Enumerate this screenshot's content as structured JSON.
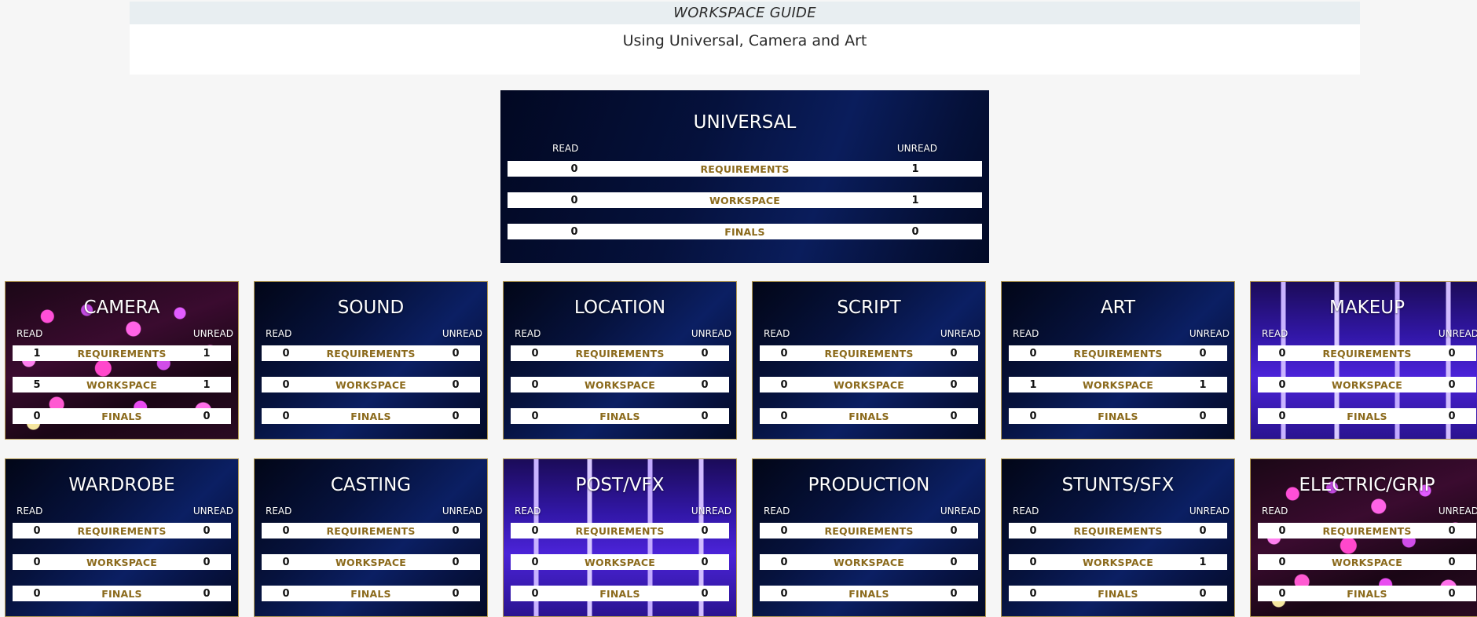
{
  "guide": {
    "title": "WORKSPACE GUIDE",
    "subtitle": "Using Universal, Camera and Art"
  },
  "columns": {
    "read": "READ",
    "unread": "UNREAD"
  },
  "row_labels": [
    "REQUIREMENTS",
    "WORKSPACE",
    "FINALS"
  ],
  "universal": {
    "title": "UNIVERSAL",
    "rows": [
      {
        "label": "REQUIREMENTS",
        "read": "0",
        "unread": "1"
      },
      {
        "label": "WORKSPACE",
        "read": "0",
        "unread": "1"
      },
      {
        "label": "FINALS",
        "read": "0",
        "unread": "0"
      }
    ]
  },
  "cards": [
    {
      "title": "CAMERA",
      "background": "lights",
      "rows": [
        {
          "label": "REQUIREMENTS",
          "read": "1",
          "unread": "1"
        },
        {
          "label": "WORKSPACE",
          "read": "5",
          "unread": "1"
        },
        {
          "label": "FINALS",
          "read": "0",
          "unread": "0"
        }
      ]
    },
    {
      "title": "SOUND",
      "background": "navy",
      "rows": [
        {
          "label": "REQUIREMENTS",
          "read": "0",
          "unread": "0"
        },
        {
          "label": "WORKSPACE",
          "read": "0",
          "unread": "0"
        },
        {
          "label": "FINALS",
          "read": "0",
          "unread": "0"
        }
      ]
    },
    {
      "title": "LOCATION",
      "background": "navy",
      "rows": [
        {
          "label": "REQUIREMENTS",
          "read": "0",
          "unread": "0"
        },
        {
          "label": "WORKSPACE",
          "read": "0",
          "unread": "0"
        },
        {
          "label": "FINALS",
          "read": "0",
          "unread": "0"
        }
      ]
    },
    {
      "title": "SCRIPT",
      "background": "navy",
      "rows": [
        {
          "label": "REQUIREMENTS",
          "read": "0",
          "unread": "0"
        },
        {
          "label": "WORKSPACE",
          "read": "0",
          "unread": "0"
        },
        {
          "label": "FINALS",
          "read": "0",
          "unread": "0"
        }
      ]
    },
    {
      "title": "ART",
      "background": "navy",
      "rows": [
        {
          "label": "REQUIREMENTS",
          "read": "0",
          "unread": "0"
        },
        {
          "label": "WORKSPACE",
          "read": "1",
          "unread": "1"
        },
        {
          "label": "FINALS",
          "read": "0",
          "unread": "0"
        }
      ]
    },
    {
      "title": "MAKEUP",
      "background": "stage",
      "rows": [
        {
          "label": "REQUIREMENTS",
          "read": "0",
          "unread": "0"
        },
        {
          "label": "WORKSPACE",
          "read": "0",
          "unread": "0"
        },
        {
          "label": "FINALS",
          "read": "0",
          "unread": "0"
        }
      ]
    },
    {
      "title": "WARDROBE",
      "background": "navy",
      "rows": [
        {
          "label": "REQUIREMENTS",
          "read": "0",
          "unread": "0"
        },
        {
          "label": "WORKSPACE",
          "read": "0",
          "unread": "0"
        },
        {
          "label": "FINALS",
          "read": "0",
          "unread": "0"
        }
      ]
    },
    {
      "title": "CASTING",
      "background": "navy",
      "rows": [
        {
          "label": "REQUIREMENTS",
          "read": "0",
          "unread": "0"
        },
        {
          "label": "WORKSPACE",
          "read": "0",
          "unread": "0"
        },
        {
          "label": "FINALS",
          "read": "0",
          "unread": "0"
        }
      ]
    },
    {
      "title": "POST/VFX",
      "background": "stage",
      "rows": [
        {
          "label": "REQUIREMENTS",
          "read": "0",
          "unread": "0"
        },
        {
          "label": "WORKSPACE",
          "read": "0",
          "unread": "0"
        },
        {
          "label": "FINALS",
          "read": "0",
          "unread": "0"
        }
      ]
    },
    {
      "title": "PRODUCTION",
      "background": "navy",
      "rows": [
        {
          "label": "REQUIREMENTS",
          "read": "0",
          "unread": "0"
        },
        {
          "label": "WORKSPACE",
          "read": "0",
          "unread": "0"
        },
        {
          "label": "FINALS",
          "read": "0",
          "unread": "0"
        }
      ]
    },
    {
      "title": "STUNTS/SFX",
      "background": "navy",
      "rows": [
        {
          "label": "REQUIREMENTS",
          "read": "0",
          "unread": "0"
        },
        {
          "label": "WORKSPACE",
          "read": "0",
          "unread": "1"
        },
        {
          "label": "FINALS",
          "read": "0",
          "unread": "0"
        }
      ]
    },
    {
      "title": "ELECTRIC/GRIP",
      "background": "lights",
      "rows": [
        {
          "label": "REQUIREMENTS",
          "read": "0",
          "unread": "0"
        },
        {
          "label": "WORKSPACE",
          "read": "0",
          "unread": "0"
        },
        {
          "label": "FINALS",
          "read": "0",
          "unread": "0"
        }
      ]
    }
  ],
  "colors": {
    "page_background": "#f6f6f6",
    "card_border": "#b49a53",
    "row_label": "#8b6a1c",
    "card_navy": "#06123d"
  }
}
